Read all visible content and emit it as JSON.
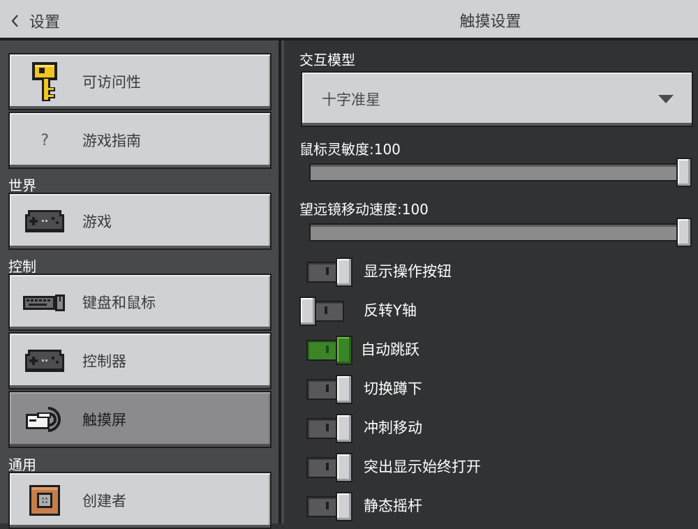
{
  "header": {
    "back_label": "设置",
    "title": "触摸设置"
  },
  "sidebar": {
    "items": [
      {
        "label": "可访问性",
        "icon": "key-icon"
      },
      {
        "label": "游戏指南",
        "icon": "question-icon",
        "glyph": "?"
      },
      {
        "label": "游戏",
        "icon": "gamepad-icon"
      },
      {
        "label": "键盘和鼠标",
        "icon": "keyboard-mouse-icon"
      },
      {
        "label": "控制器",
        "icon": "gamepad-icon"
      },
      {
        "label": "触摸屏",
        "icon": "touch-hand-icon",
        "active": true
      },
      {
        "label": "创建者",
        "icon": "command-block-icon"
      }
    ],
    "sections": {
      "world": "世界",
      "controls": "控制",
      "general": "通用"
    }
  },
  "main": {
    "interaction_model": {
      "label": "交互模型",
      "value": "十字准星"
    },
    "mouse_sensitivity": {
      "label": "鼠标灵敏度:100",
      "value": 100
    },
    "spyglass_speed": {
      "label": "望远镜移动速度:100",
      "value": 100
    },
    "toggles": [
      {
        "label": "显示操作按钮",
        "on": true
      },
      {
        "label": "反转Y轴",
        "on": false
      },
      {
        "label": "自动跳跃",
        "on": true
      },
      {
        "label": "切换蹲下",
        "on": true
      },
      {
        "label": "冲刺移动",
        "on": true
      },
      {
        "label": "突出显示始终打开",
        "on": true
      },
      {
        "label": "静态摇杆",
        "on": true
      }
    ]
  },
  "colors": {
    "panel_dark": "#313233",
    "panel_mid": "#48494a",
    "button_light": "#d0d1d4",
    "accent_green": "#3c8527"
  }
}
